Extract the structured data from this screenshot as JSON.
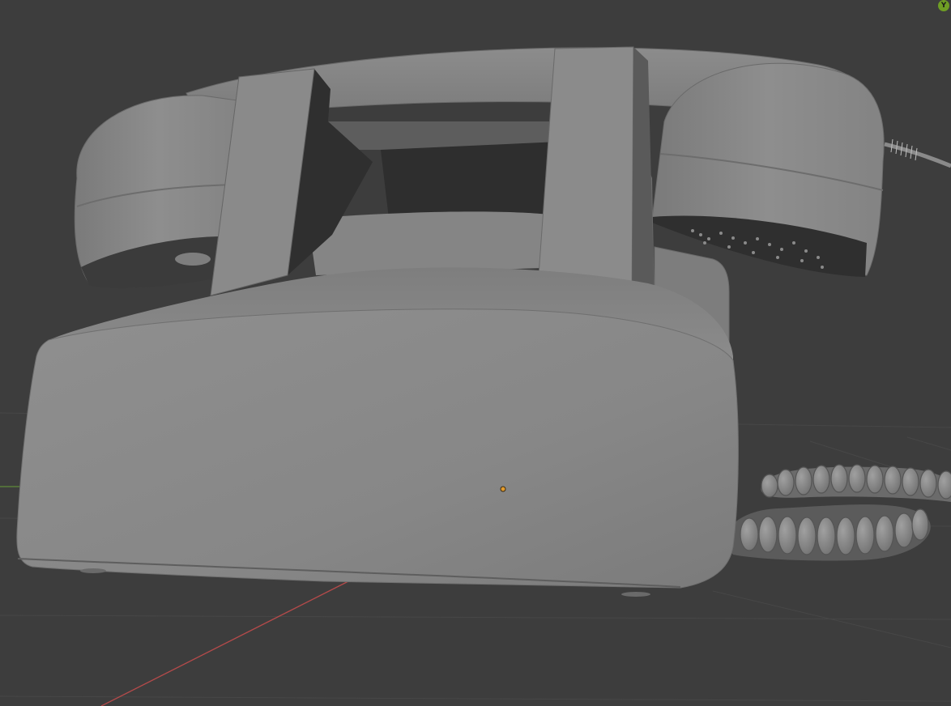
{
  "viewport": {
    "background_color": "#3d3d3d",
    "grid_line_color": "#474747",
    "x_axis_color": "#b34a4a",
    "y_axis_color": "#5f8a3a",
    "origin_point_color": "#e39b2d"
  },
  "object": {
    "type": "rotary-telephone-model",
    "shading": "solid",
    "base_color": "#8c8c8c",
    "shadow_color": "#2e2e2e"
  },
  "gizmo": {
    "axis_label": "Y",
    "axis_color": "#6f9e24",
    "icon": "navigation-gizmo-icon"
  }
}
